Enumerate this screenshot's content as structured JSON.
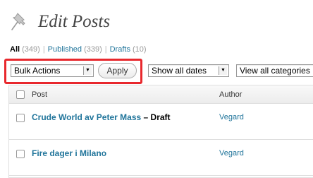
{
  "page": {
    "title": "Edit Posts",
    "icon": "pushpin-icon"
  },
  "filters": {
    "all_label": "All",
    "all_count": "(349)",
    "published_label": "Published",
    "published_count": "(339)",
    "drafts_label": "Drafts",
    "drafts_count": "(10)",
    "separator": "|"
  },
  "toolbar": {
    "bulk_actions": "Bulk Actions",
    "apply_label": "Apply",
    "dates_filter": "Show all dates",
    "categories_filter": "View all categories"
  },
  "table": {
    "columns": [
      "Post",
      "Author"
    ],
    "rows": [
      {
        "title": "Crude World av Peter Mass",
        "state": "– Draft",
        "author": "Vegard"
      },
      {
        "title": "Fire dager i Milano",
        "state": "",
        "author": "Vegard"
      }
    ]
  },
  "colors": {
    "link": "#21759b",
    "highlight": "#e8282d"
  }
}
